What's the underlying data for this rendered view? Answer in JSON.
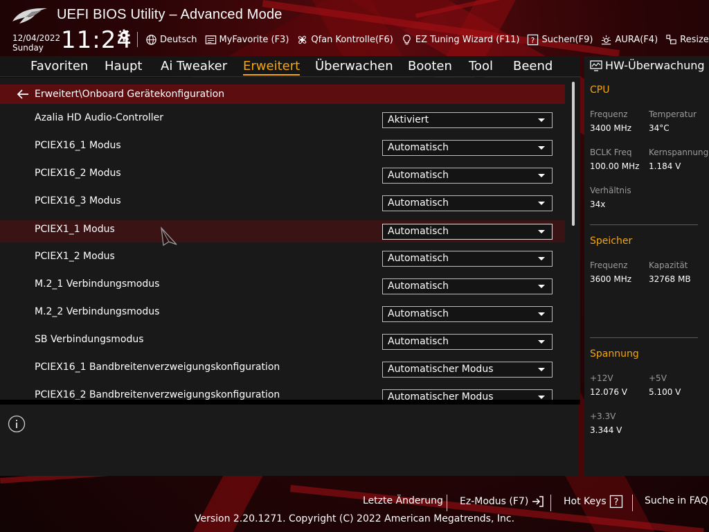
{
  "header": {
    "title": "UEFI BIOS Utility – Advanced Mode",
    "date": "12/04/2022",
    "day": "Sunday",
    "time": "11:24",
    "tools": [
      {
        "label": "Deutsch",
        "icon": "globe-icon"
      },
      {
        "label": "MyFavorite (F3)",
        "icon": "favorite-list-icon"
      },
      {
        "label": "Qfan Kontrolle(F6)",
        "icon": "fan-icon"
      },
      {
        "label": "EZ Tuning Wizard (F11)",
        "icon": "lightbulb-icon"
      },
      {
        "label": "Suchen(F9)",
        "icon": "help-search-icon"
      },
      {
        "label": "AURA(F4)",
        "icon": "aura-light-icon"
      },
      {
        "label": "Resize BAR",
        "icon": "resize-bar-icon"
      }
    ]
  },
  "nav": {
    "tabs": [
      "Favoriten",
      "Haupt",
      "Ai Tweaker",
      "Erweitert",
      "Überwachen",
      "Booten",
      "Tool",
      "Beend"
    ],
    "active": "Erweitert"
  },
  "main": {
    "breadcrumb": "Erweitert\\Onboard Gerätekonfiguration",
    "settings": [
      {
        "label": "Azalia HD Audio-Controller",
        "value": "Aktiviert"
      },
      {
        "label": "PCIEX16_1 Modus",
        "value": "Automatisch"
      },
      {
        "label": "PCIEX16_2 Modus",
        "value": "Automatisch"
      },
      {
        "label": "PCIEX16_3 Modus",
        "value": "Automatisch"
      },
      {
        "label": "PCIEX1_1 Modus",
        "value": "Automatisch"
      },
      {
        "label": "PCIEX1_2 Modus",
        "value": "Automatisch"
      },
      {
        "label": "M.2_1 Verbindungsmodus",
        "value": "Automatisch"
      },
      {
        "label": "M.2_2 Verbindungsmodus",
        "value": "Automatisch"
      },
      {
        "label": "SB Verbindungsmodus",
        "value": "Automatisch"
      },
      {
        "label": "PCIEX16_1 Bandbreitenverzweigungskonfiguration",
        "value": "Automatischer Modus"
      },
      {
        "label": "PCIEX16_2 Bandbreitenverzweigungskonfiguration",
        "value": "Automatischer Modus"
      }
    ],
    "highlighted_row": 4
  },
  "hw_monitor": {
    "title": "HW-Überwachung",
    "cpu": {
      "heading": "CPU",
      "freq_label": "Frequenz",
      "freq": "3400 MHz",
      "temp_label": "Temperatur",
      "temp": "34°C",
      "bclk_label": "BCLK Freq",
      "bclk": "100.00 MHz",
      "vcore_label": "Kernspannung",
      "vcore": "1.184 V",
      "ratio_label": "Verhältnis",
      "ratio": "34x"
    },
    "memory": {
      "heading": "Speicher",
      "freq_label": "Frequenz",
      "freq": "3600 MHz",
      "cap_label": "Kapazität",
      "cap": "32768 MB"
    },
    "voltage": {
      "heading": "Spannung",
      "v12_label": "+12V",
      "v12": "12.076 V",
      "v5_label": "+5V",
      "v5": "5.100 V",
      "v33_label": "+3.3V",
      "v33": "3.344 V"
    }
  },
  "footer": {
    "last_change": "Letzte Änderung",
    "ez_mode": "Ez-Modus (F7)",
    "hot_keys": "Hot Keys",
    "faq": "Suche in FAQ",
    "version": "Version 2.20.1271. Copyright (C) 2022 American Megatrends, Inc."
  },
  "colors": {
    "accent": "#f3a60f",
    "breadcrumb_bg": "#5b0d10",
    "highlight_row": "#3a1315"
  }
}
